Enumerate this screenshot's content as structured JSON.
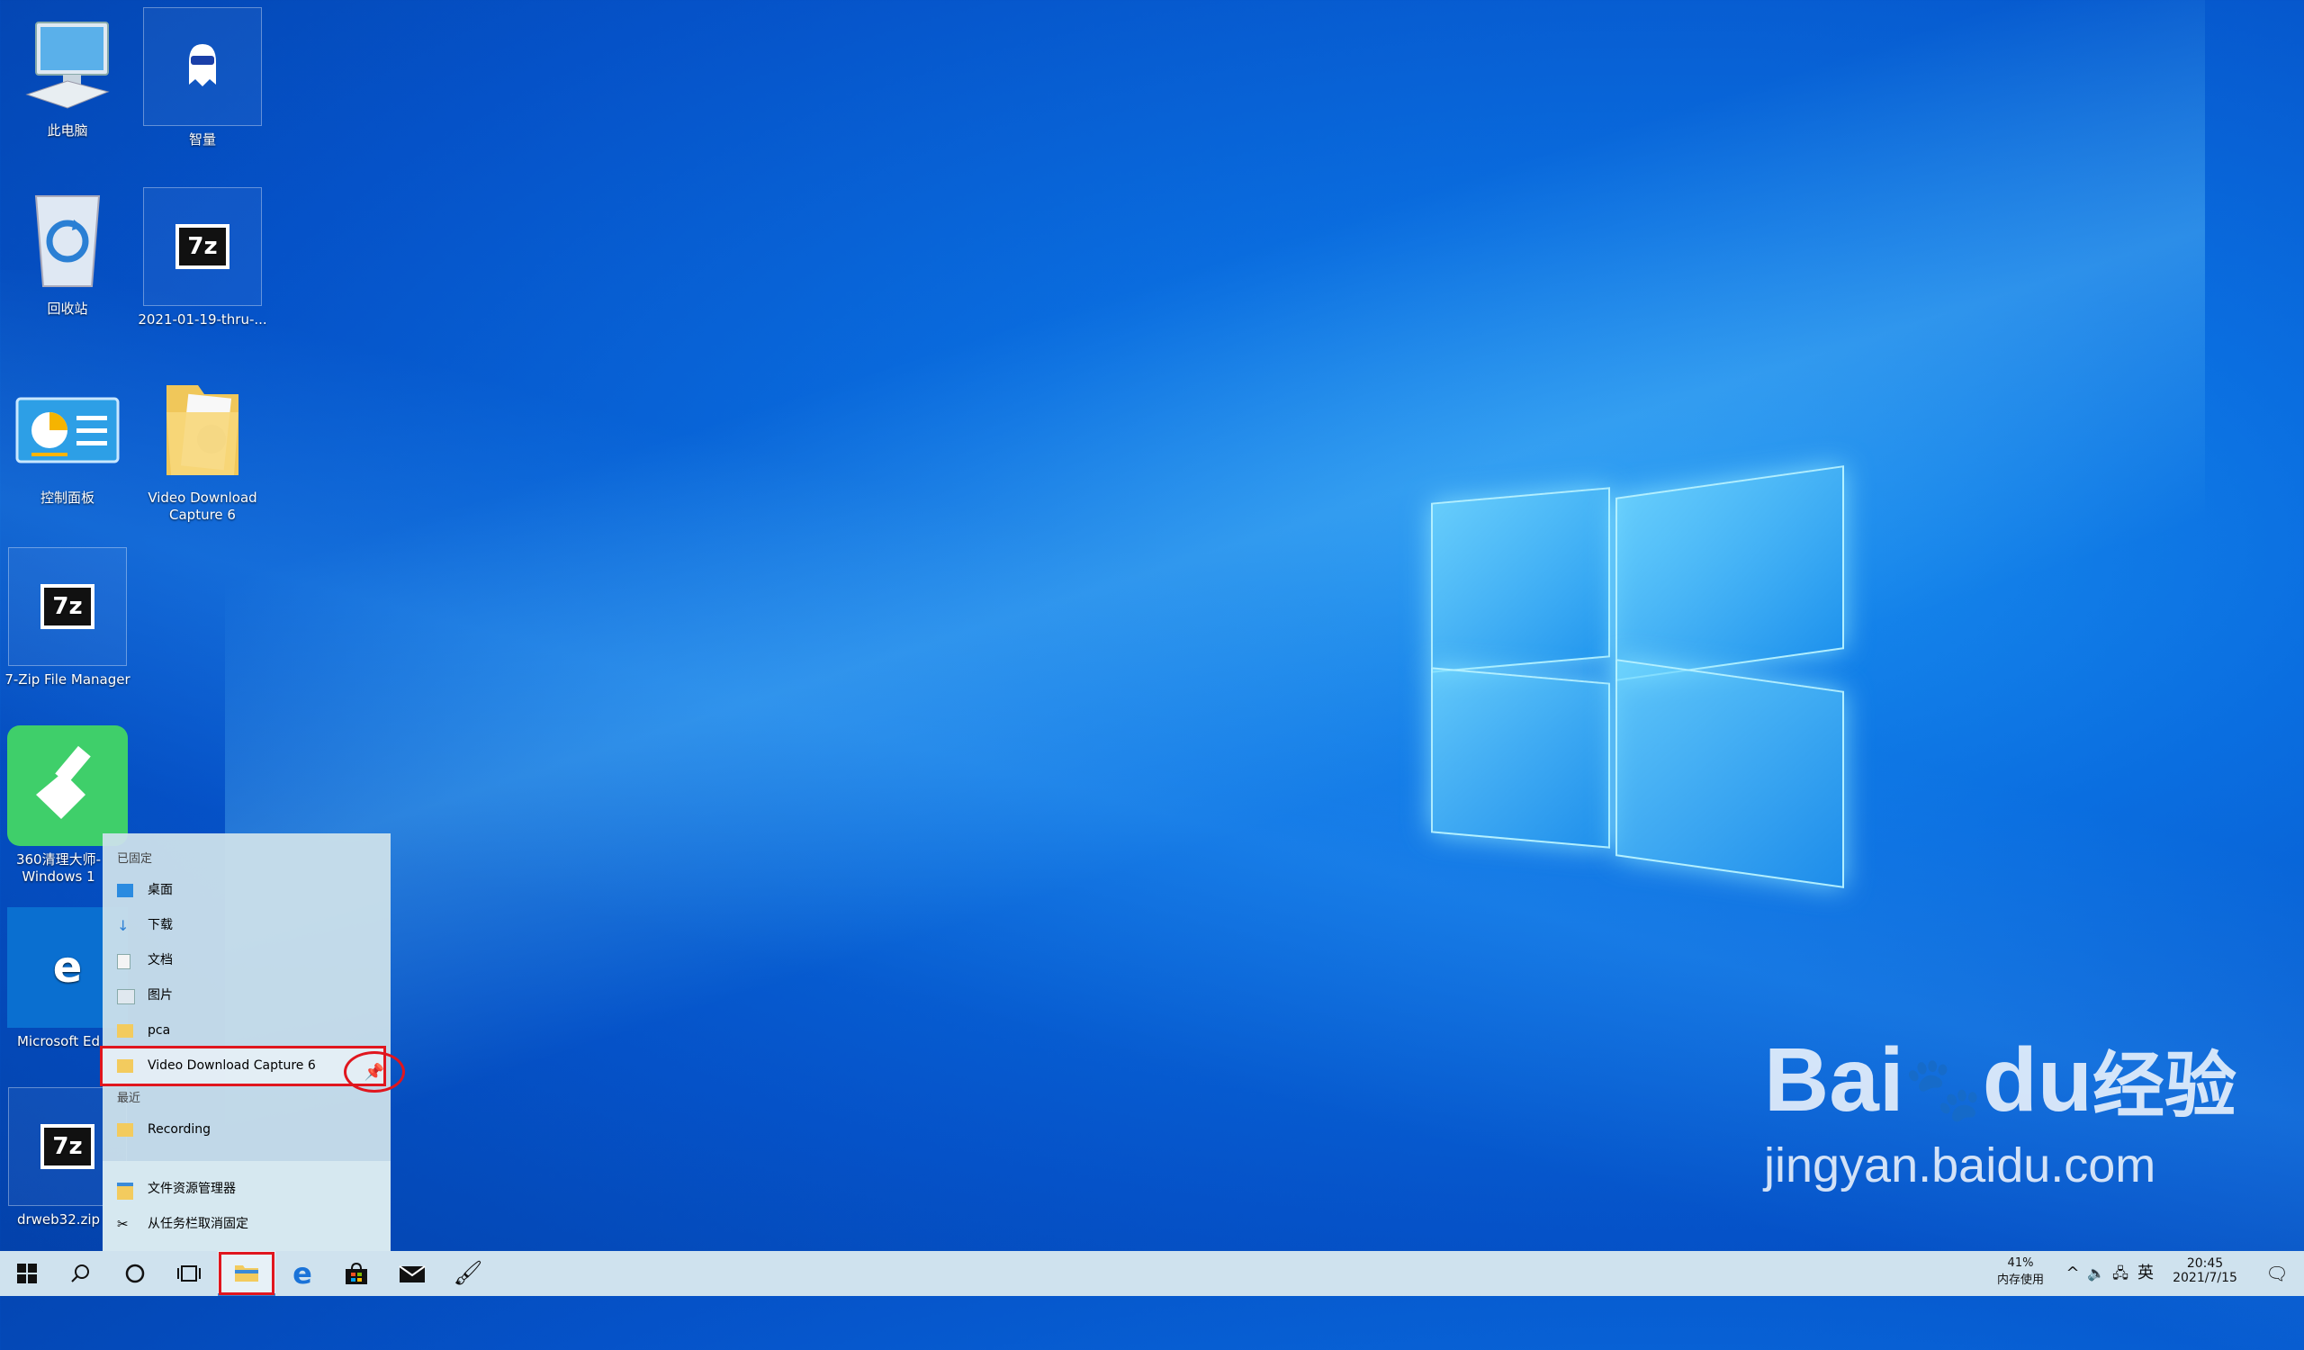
{
  "desktop_icons": [
    {
      "label": "此电脑",
      "icon": "computer-icon"
    },
    {
      "label": "智量",
      "icon": "ghost-icon"
    },
    {
      "label": "回收站",
      "icon": "recycle-bin-icon"
    },
    {
      "label": "2021-01-19-thru-...",
      "icon": "7z-archive-icon",
      "glyph": "7z"
    },
    {
      "label": "控制面板",
      "icon": "control-panel-icon"
    },
    {
      "label": "Video Download Capture 6",
      "icon": "folder-icon"
    },
    {
      "label": "7-Zip File Manager",
      "icon": "7zip-icon",
      "glyph": "7z"
    },
    {
      "label": "360清理大师-Windows 1",
      "icon": "broom-app-icon"
    },
    {
      "label": "Microsoft Ed",
      "icon": "edge-icon",
      "glyph": "e"
    },
    {
      "label": "drweb32.zip",
      "icon": "7z-archive-icon",
      "glyph": "7z"
    }
  ],
  "jumplist": {
    "pinned_header": "已固定",
    "pinned": [
      {
        "label": "桌面",
        "icon": "desktop-folder-icon"
      },
      {
        "label": "下载",
        "icon": "download-icon"
      },
      {
        "label": "文档",
        "icon": "document-icon"
      },
      {
        "label": "图片",
        "icon": "pictures-icon"
      },
      {
        "label": "pca",
        "icon": "folder-icon"
      },
      {
        "label": "Video Download Capture 6",
        "icon": "folder-icon"
      }
    ],
    "recent_header": "最近",
    "recent": [
      {
        "label": "Recording",
        "icon": "folder-icon"
      }
    ],
    "actions": [
      {
        "label": "文件资源管理器",
        "icon": "file-explorer-icon"
      },
      {
        "label": "从任务栏取消固定",
        "icon": "unpin-icon"
      }
    ]
  },
  "taskbar": {
    "memory_percent": "41%",
    "memory_label": "内存使用",
    "ime": "英",
    "time": "20:45",
    "date": "2021/7/15"
  },
  "watermark": {
    "brand": "Bai",
    "brand2": "du",
    "brand_cn": "经验",
    "url": "jingyan.baidu.com"
  }
}
